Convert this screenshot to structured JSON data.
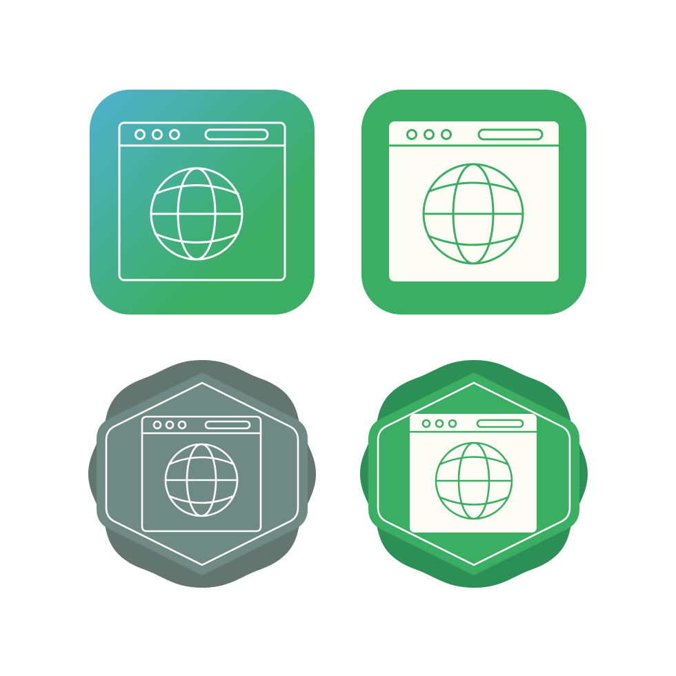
{
  "icons": [
    {
      "id": "tile-1",
      "icon": "browser-globe-icon",
      "style": "line-gradient-rounded-square",
      "colors": {
        "gradient_start": "#4fb1cf",
        "gradient_end": "#3bae63",
        "line": "#ffffff"
      }
    },
    {
      "id": "tile-2",
      "icon": "browser-globe-icon",
      "style": "glyph-rounded-square",
      "colors": {
        "background": "#3aae63",
        "window": "#fdfdf6",
        "line": "#3aae63"
      }
    },
    {
      "id": "tile-3",
      "icon": "browser-globe-icon",
      "style": "line-badge",
      "colors": {
        "badge_outer": "#62756e",
        "badge_inner": "#6e8a82",
        "line": "#ffffff"
      }
    },
    {
      "id": "tile-4",
      "icon": "browser-globe-icon",
      "style": "glyph-badge",
      "colors": {
        "badge_outer": "#2c8f56",
        "badge_inner": "#3aae63",
        "window": "#fdfdf6",
        "line": "#3aae63",
        "frame": "#ffffff"
      }
    }
  ]
}
